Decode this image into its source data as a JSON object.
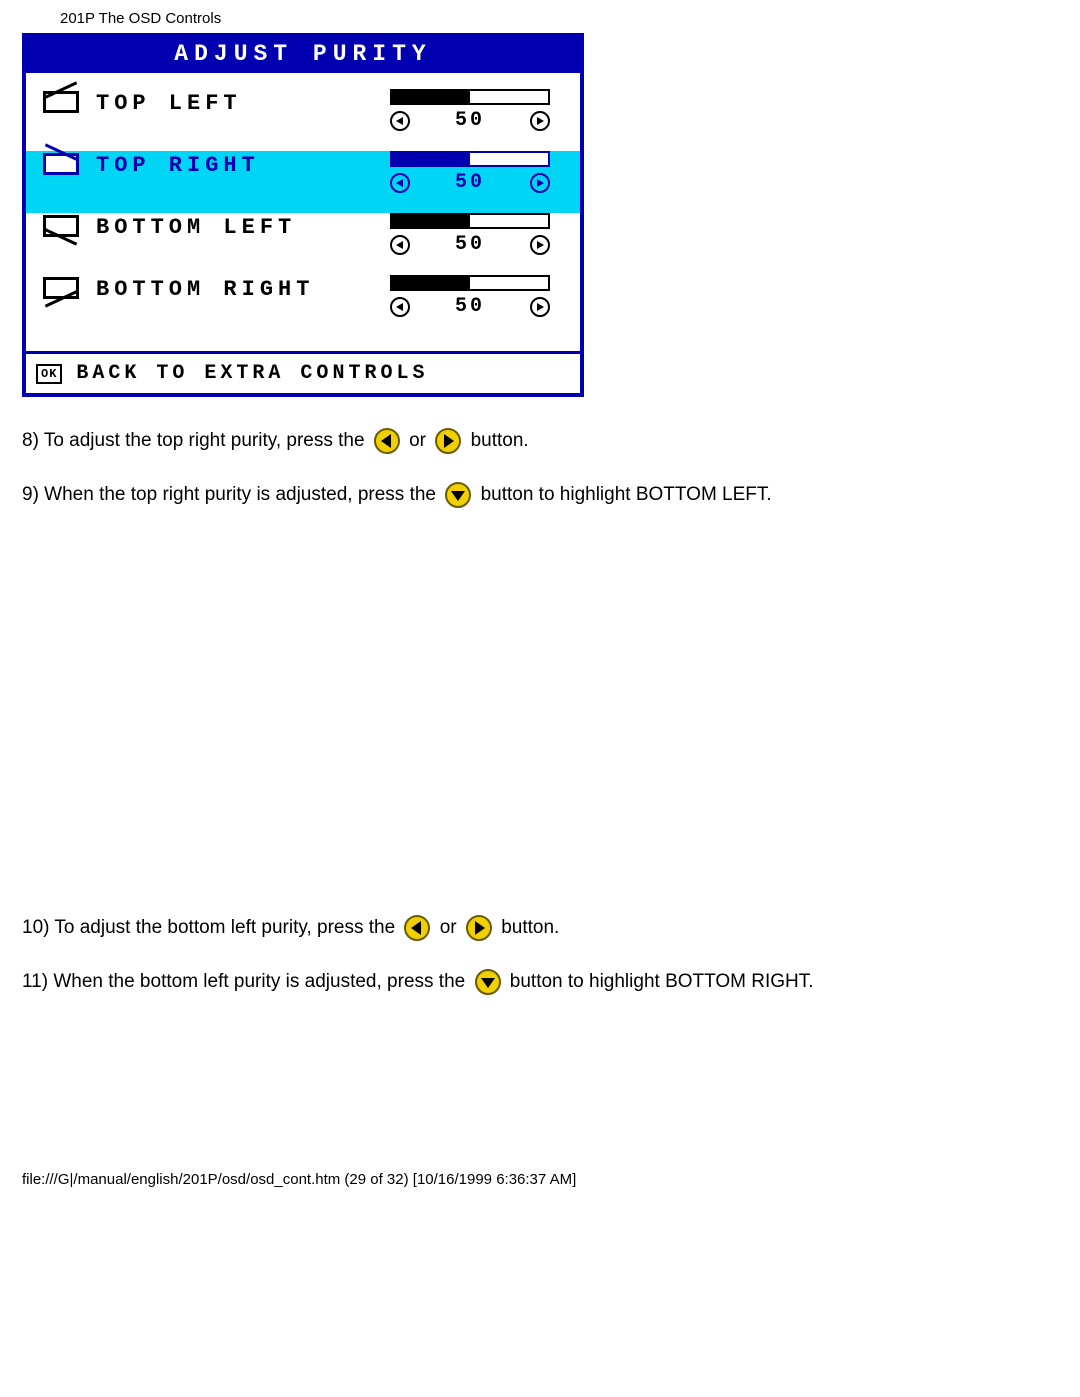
{
  "page_header": "201P The OSD Controls",
  "osd": {
    "title": "ADJUST PURITY",
    "items": [
      {
        "label": "TOP LEFT",
        "value": "50",
        "selected": false,
        "icon": "tl"
      },
      {
        "label": "TOP RIGHT",
        "value": "50",
        "selected": true,
        "icon": "tr"
      },
      {
        "label": "BOTTOM LEFT",
        "value": "50",
        "selected": false,
        "icon": "bl"
      },
      {
        "label": "BOTTOM RIGHT",
        "value": "50",
        "selected": false,
        "icon": "br"
      }
    ],
    "ok_label": "OK",
    "back_label": "BACK TO EXTRA CONTROLS"
  },
  "instructions": {
    "step8_a": "8) To adjust the top right purity, press the",
    "step8_or": "or",
    "step8_b": "button.",
    "step9_a": "9) When the top right purity is adjusted, press the",
    "step9_b": "button to highlight BOTTOM LEFT.",
    "step10_a": "10) To adjust the bottom left purity, press the",
    "step10_or": "or",
    "step10_b": "button.",
    "step11_a": "11) When the bottom left purity is adjusted, press the",
    "step11_b": "button to highlight BOTTOM RIGHT."
  },
  "footer_path": "file:///G|/manual/english/201P/osd/osd_cont.htm (29 of 32) [10/16/1999 6:36:37 AM]"
}
